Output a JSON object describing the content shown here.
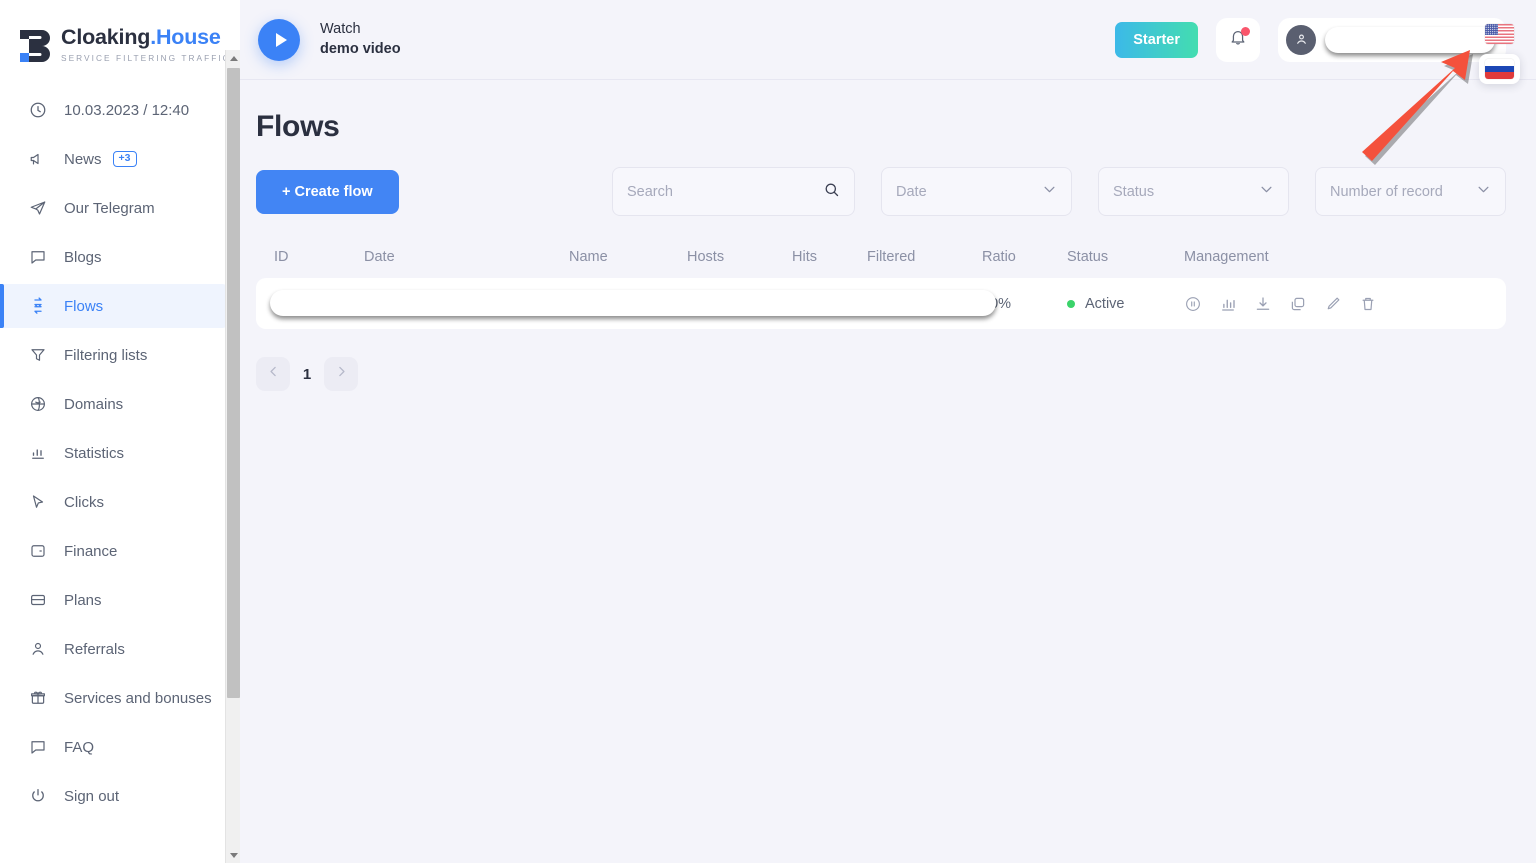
{
  "brand": {
    "name_main": "Cloaking",
    "name_accent": ".House",
    "tagline": "SERVICE FILTERING TRAFFIC"
  },
  "sidebar": {
    "datetime": "10.03.2023 / 12:40",
    "items": [
      {
        "label": "News",
        "icon": "megaphone-icon",
        "badge": "+3"
      },
      {
        "label": "Our Telegram",
        "icon": "telegram-icon"
      },
      {
        "label": "Blogs",
        "icon": "chat-icon"
      },
      {
        "label": "Flows",
        "icon": "flows-icon",
        "active": true
      },
      {
        "label": "Filtering lists",
        "icon": "funnel-icon"
      },
      {
        "label": "Domains",
        "icon": "globe-icon"
      },
      {
        "label": "Statistics",
        "icon": "bar-chart-icon"
      },
      {
        "label": "Clicks",
        "icon": "cursor-icon"
      },
      {
        "label": "Finance",
        "icon": "wallet-icon"
      },
      {
        "label": "Plans",
        "icon": "card-icon"
      },
      {
        "label": "Referrals",
        "icon": "user-icon"
      },
      {
        "label": "Services and bonuses",
        "icon": "gift-icon"
      },
      {
        "label": "FAQ",
        "icon": "chat-icon"
      },
      {
        "label": "Sign out",
        "icon": "power-icon"
      }
    ]
  },
  "header": {
    "demo_line1": "Watch",
    "demo_line2": "demo video",
    "plan_label": "Starter",
    "plan_gradient_from": "#3cb9e8",
    "plan_gradient_to": "#43ddb0",
    "notification_dot_color": "#f9566c",
    "language_current": "us-flag-icon",
    "language_option": "ru-flag-icon"
  },
  "page": {
    "title": "Flows",
    "create_button": "+ Create flow"
  },
  "filters": {
    "search_placeholder": "Search",
    "date_label": "Date",
    "status_label": "Status",
    "records_label": "Number of record"
  },
  "table": {
    "columns": [
      "ID",
      "Date",
      "Name",
      "Hosts",
      "Hits",
      "Filtered",
      "Ratio",
      "Status",
      "Management"
    ],
    "rows": [
      {
        "ratio": "60%",
        "status": "Active",
        "status_color": "#3ad36a",
        "actions": [
          "pause-icon",
          "chart-icon",
          "download-icon",
          "copy-icon",
          "edit-icon",
          "delete-icon"
        ]
      }
    ]
  },
  "pagination": {
    "prev": "chevron-left-icon",
    "current_page": "1",
    "next": "chevron-right-icon"
  },
  "annotation": {
    "arrow_color": "#f4513c"
  }
}
